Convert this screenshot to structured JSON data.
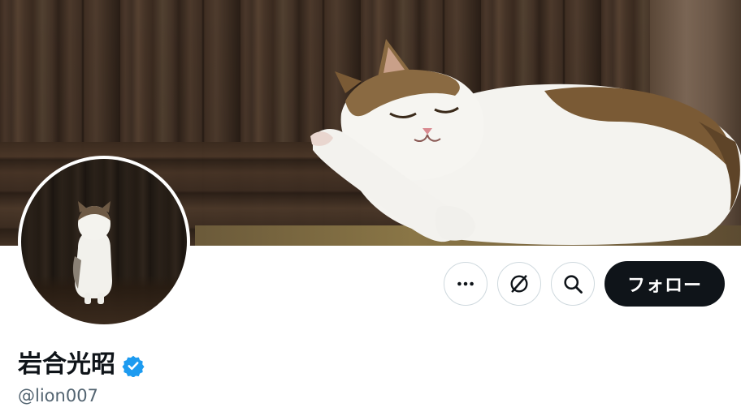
{
  "profile": {
    "display_name": "岩合光昭",
    "handle": "@lion007",
    "verified": true
  },
  "actions": {
    "more_icon": "more-horizontal-icon",
    "grok_icon": "grok-icon",
    "search_icon": "search-icon",
    "follow_label": "フォロー"
  },
  "colors": {
    "follow_bg": "#0f1419",
    "follow_text": "#ffffff",
    "handle_text": "#536471",
    "verified_badge": "#1d9bf0",
    "button_border": "#cfd9de"
  }
}
